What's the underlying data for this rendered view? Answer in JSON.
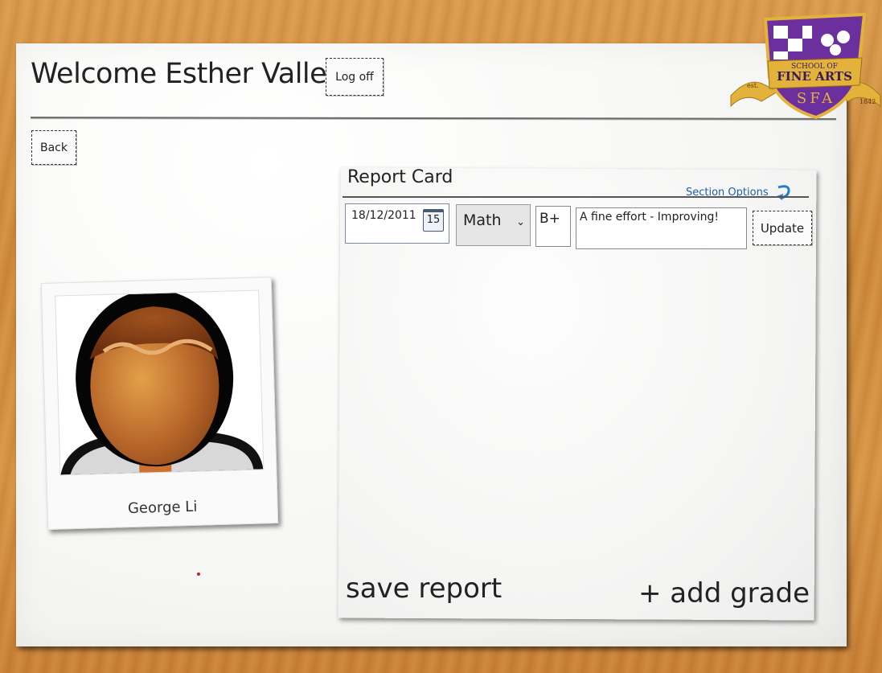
{
  "header": {
    "welcome_text": "Welcome Esther Valle!",
    "logoff_label": "Log off"
  },
  "nav": {
    "back_label": "Back"
  },
  "logo": {
    "line1": "SCHOOL OF",
    "line2": "FINE ARTS",
    "initials": "SFA",
    "est_label": "est.",
    "year": "1842",
    "colors": {
      "shield": "#6b2f9e",
      "ribbon": "#e3b23a"
    }
  },
  "student": {
    "name": "George Li",
    "photo_icon": "student-avatar-icon"
  },
  "report_card": {
    "title": "Report Card",
    "section_options_label": "Section Options",
    "section_options_icon": "curved-arrow-icon",
    "row": {
      "date": "18/12/2011",
      "calendar_day": "15",
      "subject": "Math",
      "grade": "B+",
      "comment": "A fine effort - Improving!",
      "update_label": "Update"
    },
    "save_label": "save report",
    "add_grade_label": "+ add grade"
  }
}
